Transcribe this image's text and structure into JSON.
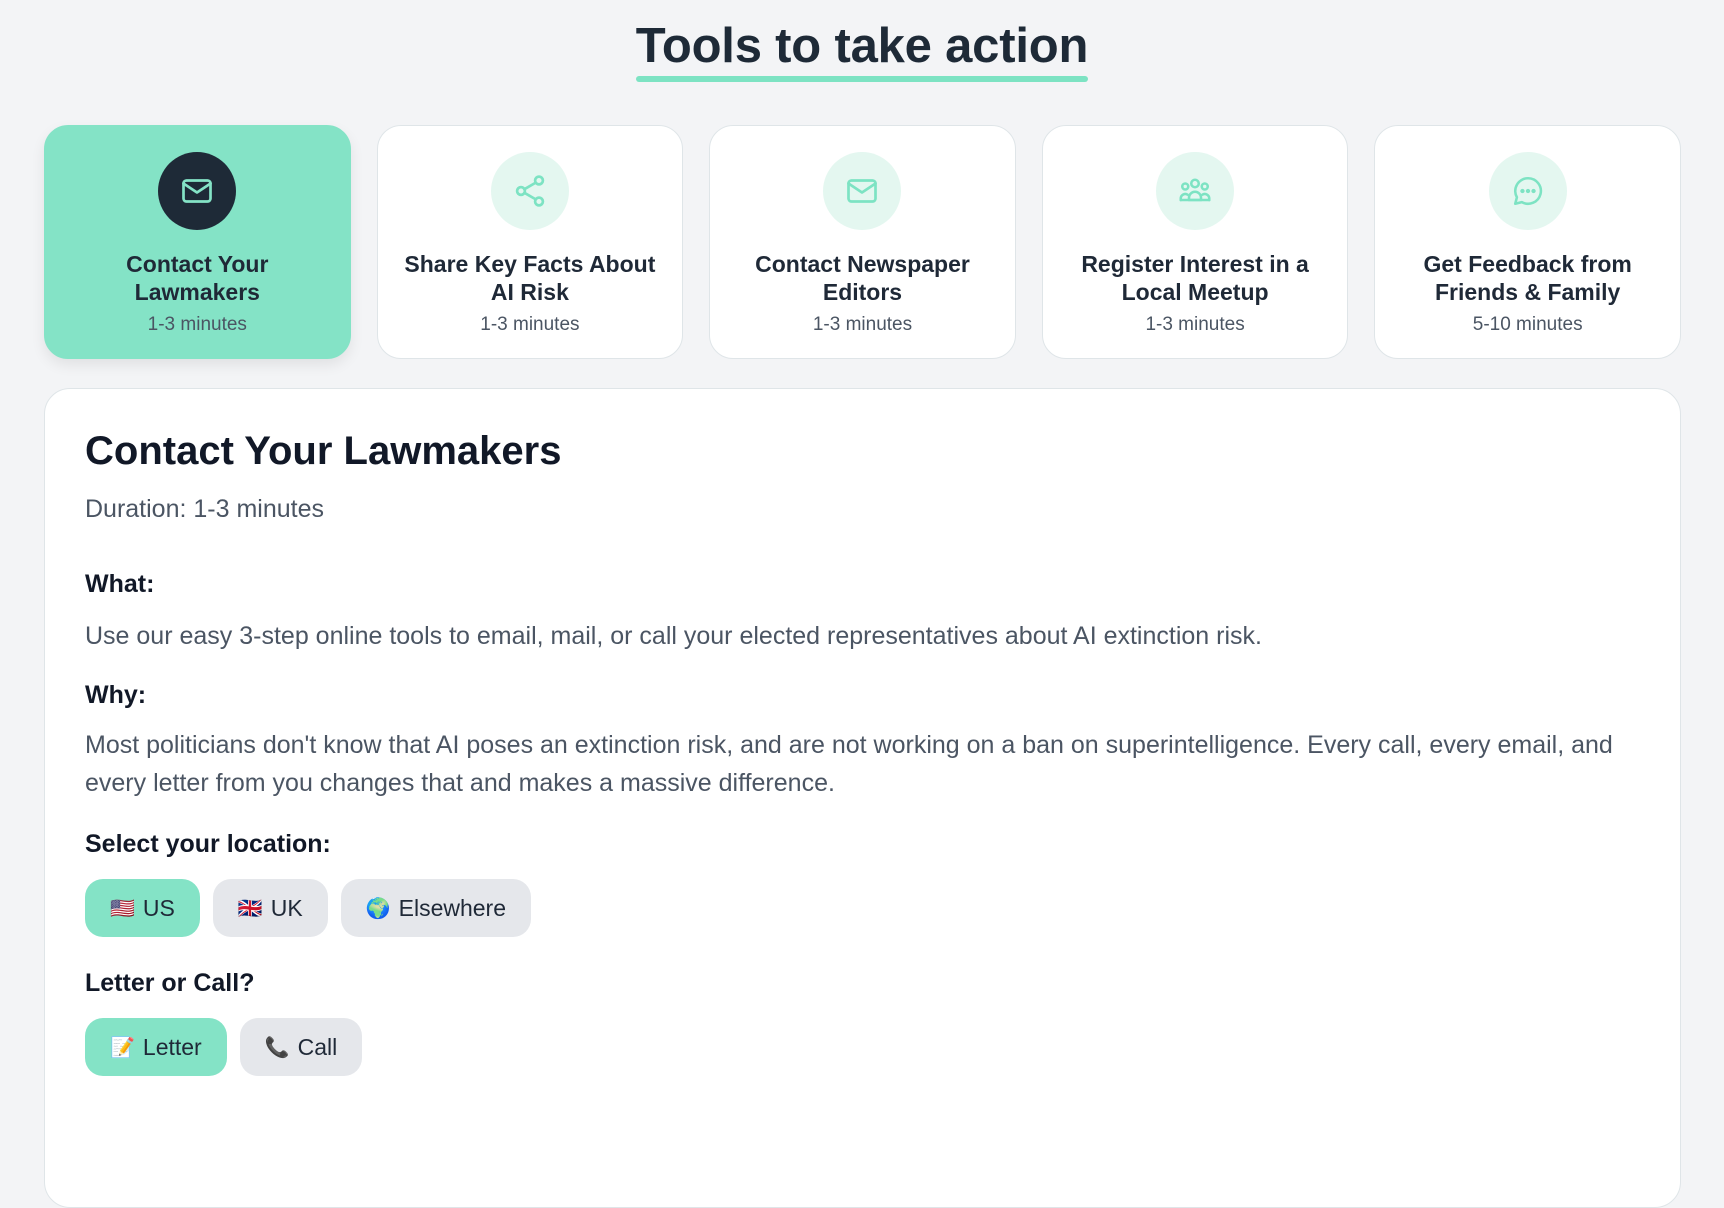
{
  "header": {
    "title": "Tools to take action"
  },
  "cards": [
    {
      "title_line1": "Contact Your",
      "title_line2": "Lawmakers",
      "duration": "1-3 minutes",
      "icon": "mail-icon",
      "active": true
    },
    {
      "title_line1": "Share Key Facts About",
      "title_line2": "AI Risk",
      "duration": "1-3 minutes",
      "icon": "share-icon",
      "active": false
    },
    {
      "title_line1": "Contact Newspaper",
      "title_line2": "Editors",
      "duration": "1-3 minutes",
      "icon": "mail-icon",
      "active": false
    },
    {
      "title_line1": "Register Interest in a",
      "title_line2": "Local Meetup",
      "duration": "1-3 minutes",
      "icon": "people-icon",
      "active": false
    },
    {
      "title_line1": "Get Feedback from",
      "title_line2": "Friends & Family",
      "duration": "5-10 minutes",
      "icon": "chat-bubble-icon",
      "active": false
    }
  ],
  "detail": {
    "title": "Contact Your Lawmakers",
    "duration": "Duration: 1-3 minutes",
    "what_label": "What:",
    "what_text": "Use our easy 3-step online tools to email, mail, or call your elected representatives about AI extinction risk.",
    "why_label": "Why:",
    "why_text": "Most politicians don't know that AI poses an extinction risk, and are not working on a ban on superintelligence. Every call, every email, and every letter from you changes that and makes a massive difference.",
    "location_label": "Select your location:",
    "locations": [
      {
        "emoji": "🇺🇸",
        "label": "US",
        "active": true
      },
      {
        "emoji": "🇬🇧",
        "label": "UK",
        "active": false
      },
      {
        "emoji": "🌍",
        "label": "Elsewhere",
        "active": false
      }
    ],
    "mode_label": "Letter or Call?",
    "modes": [
      {
        "emoji": "📝",
        "label": "Letter",
        "active": true
      },
      {
        "emoji": "📞",
        "label": "Call",
        "active": false
      }
    ]
  },
  "colors": {
    "accent": "#84e3c6",
    "dark": "#1e2a37",
    "background": "#f3f4f6"
  }
}
